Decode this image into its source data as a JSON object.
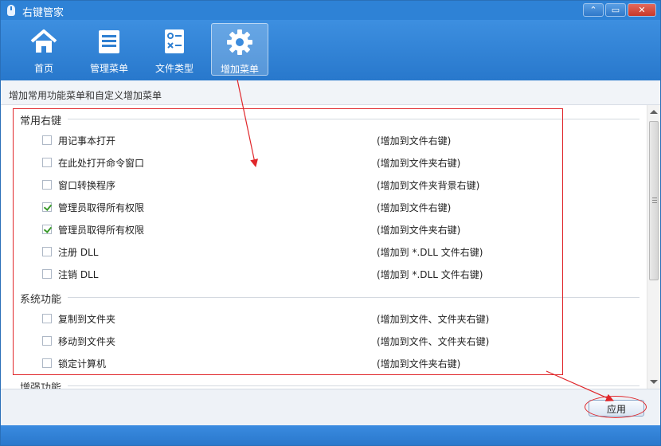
{
  "window": {
    "title": "右键管家",
    "controls": [
      "⌃",
      "▭",
      "✕"
    ]
  },
  "toolbar": {
    "items": [
      {
        "label": "首页",
        "icon": "home-icon"
      },
      {
        "label": "管理菜单",
        "icon": "list-icon"
      },
      {
        "label": "文件类型",
        "icon": "file-check-icon"
      },
      {
        "label": "增加菜单",
        "icon": "gear-icon",
        "active": true
      }
    ]
  },
  "subtitle": "增加常用功能菜单和自定义增加菜单",
  "sections": [
    {
      "title": "常用右键",
      "items": [
        {
          "label": "用记事本打开",
          "desc": "(增加到文件右键)",
          "checked": false
        },
        {
          "label": "在此处打开命令窗口",
          "desc": "(增加到文件夹右键)",
          "checked": false
        },
        {
          "label": "窗口转换程序",
          "desc": "(增加到文件夹背景右键)",
          "checked": false
        },
        {
          "label": "管理员取得所有权限",
          "desc": "(增加到文件右键)",
          "checked": true
        },
        {
          "label": "管理员取得所有权限",
          "desc": "(增加到文件夹右键)",
          "checked": true
        },
        {
          "label": "注册 DLL",
          "desc": "(增加到 *.DLL 文件右键)",
          "checked": false
        },
        {
          "label": "注销 DLL",
          "desc": "(增加到 *.DLL 文件右键)",
          "checked": false
        }
      ]
    },
    {
      "title": "系统功能",
      "items": [
        {
          "label": "复制到文件夹",
          "desc": "(增加到文件、文件夹右键)",
          "checked": false
        },
        {
          "label": "移动到文件夹",
          "desc": "(增加到文件、文件夹右键)",
          "checked": false
        },
        {
          "label": "锁定计算机",
          "desc": "(增加到文件夹右键)",
          "checked": false
        }
      ]
    },
    {
      "title": "增强功能",
      "items": []
    }
  ],
  "apply_label": "应用",
  "colors": {
    "titlebar": "#2e82d6",
    "toolbar": "#3d8fe0",
    "annotation": "#e0262a",
    "check": "#3a9a2a"
  }
}
